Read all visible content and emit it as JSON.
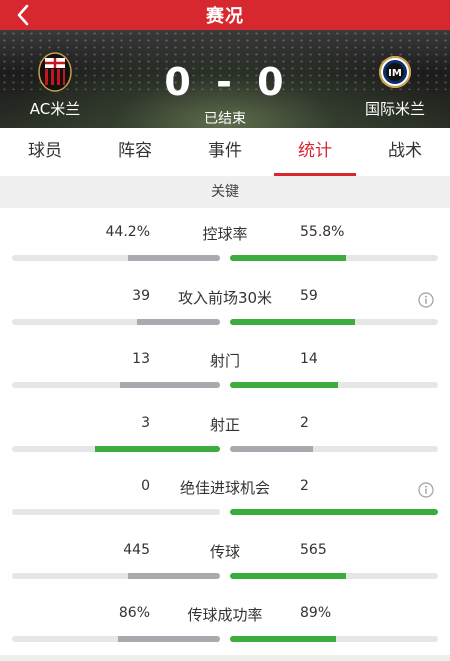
{
  "header": {
    "title": "赛况",
    "back_icon": "chevron-left-icon"
  },
  "match": {
    "home_team": "AC米兰",
    "away_team": "国际米兰",
    "home_score": "0",
    "away_score": "0",
    "score_separator": "-",
    "status": "已结束",
    "home_crest_icon": "ac-milan-crest",
    "away_crest_icon": "inter-milan-crest"
  },
  "tabs": [
    {
      "label": "球员"
    },
    {
      "label": "阵容"
    },
    {
      "label": "事件"
    },
    {
      "label": "统计",
      "active": true
    },
    {
      "label": "战术"
    }
  ],
  "section": {
    "title": "关键"
  },
  "colors": {
    "accent": "#d7282f",
    "winning_bar": "#3cad3c",
    "losing_bar": "#a9a9af",
    "track": "#e6e6e6"
  },
  "stats": [
    {
      "label": "控球率",
      "home": "44.2%",
      "away": "55.8%",
      "home_fraction": 0.442,
      "away_fraction": 0.558,
      "leader": "away",
      "info": false
    },
    {
      "label": "攻入前场30米",
      "home": "39",
      "away": "59",
      "home_fraction": 0.398,
      "away_fraction": 0.602,
      "leader": "away",
      "info": true
    },
    {
      "label": "射门",
      "home": "13",
      "away": "14",
      "home_fraction": 0.481,
      "away_fraction": 0.519,
      "leader": "away",
      "info": false
    },
    {
      "label": "射正",
      "home": "3",
      "away": "2",
      "home_fraction": 0.6,
      "away_fraction": 0.4,
      "leader": "home",
      "info": false
    },
    {
      "label": "绝佳进球机会",
      "home": "0",
      "away": "2",
      "home_fraction": 0.0,
      "away_fraction": 1.0,
      "leader": "away",
      "info": true
    },
    {
      "label": "传球",
      "home": "445",
      "away": "565",
      "home_fraction": 0.441,
      "away_fraction": 0.559,
      "leader": "away",
      "info": false
    },
    {
      "label": "传球成功率",
      "home": "86%",
      "away": "89%",
      "home_fraction": 0.491,
      "away_fraction": 0.509,
      "leader": "away",
      "info": false
    }
  ]
}
